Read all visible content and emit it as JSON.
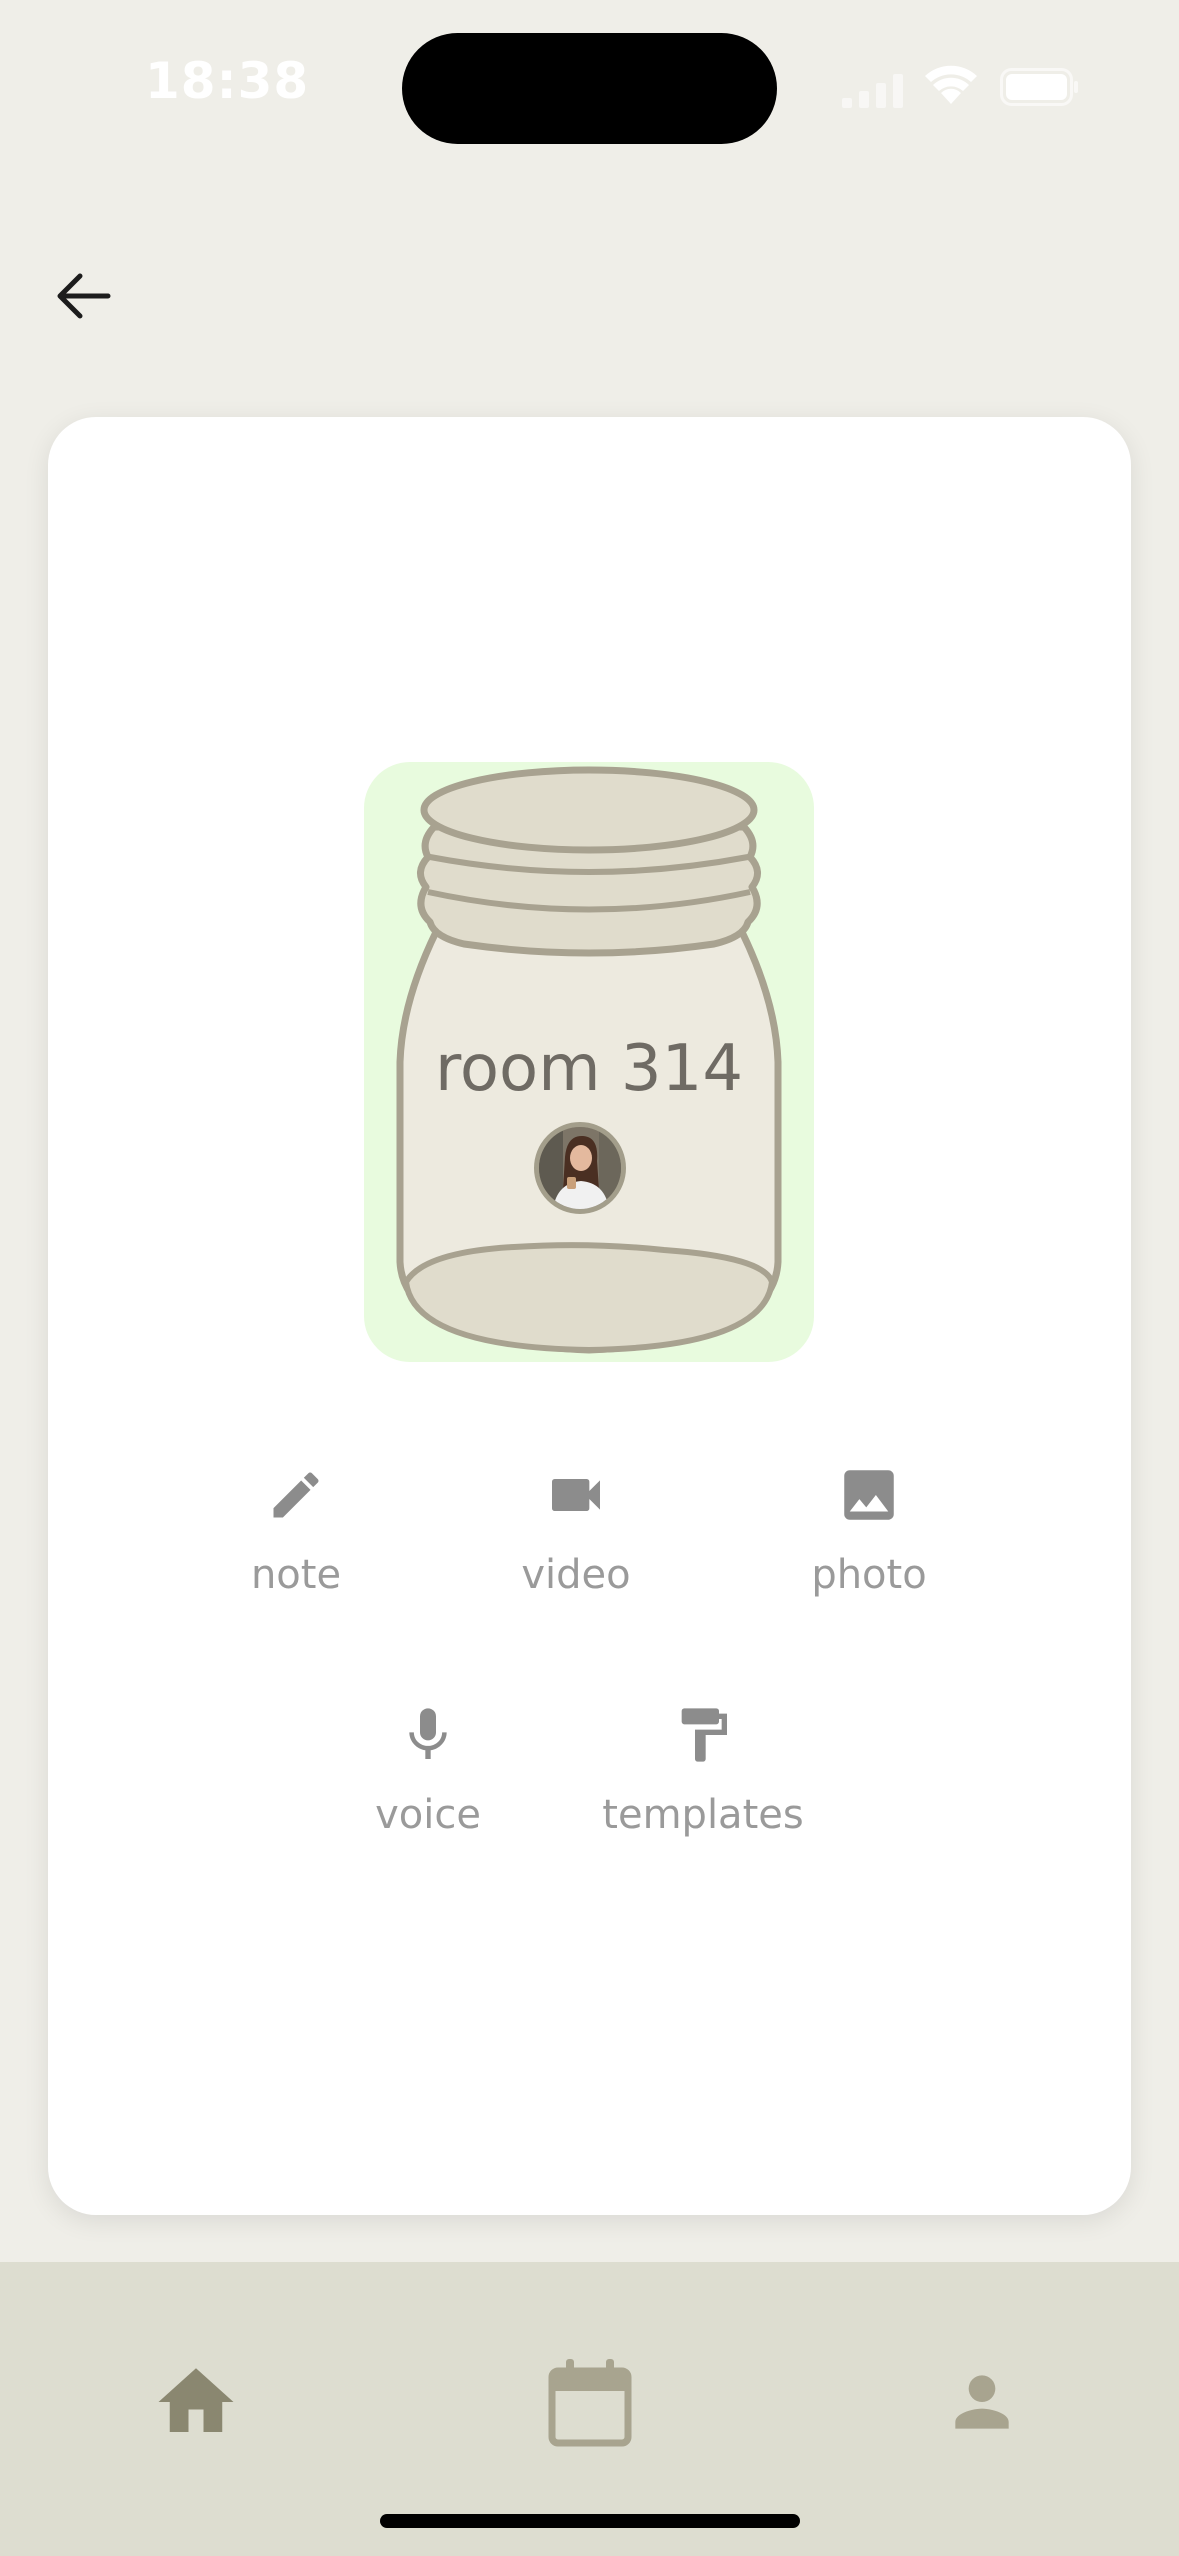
{
  "status_bar": {
    "time": "18:38"
  },
  "header": {
    "back_icon": "arrow-back-icon"
  },
  "jar": {
    "title": "room 314",
    "background_color": "#e8fbde",
    "avatar_icon": "profile-photo"
  },
  "actions": {
    "note": {
      "label": "note",
      "icon": "pencil-icon"
    },
    "video": {
      "label": "video",
      "icon": "videocam-icon"
    },
    "photo": {
      "label": "photo",
      "icon": "image-icon"
    },
    "voice": {
      "label": "voice",
      "icon": "mic-icon"
    },
    "templates": {
      "label": "templates",
      "icon": "paint-roller-icon"
    }
  },
  "bottom_nav": {
    "items": [
      {
        "icon": "home-icon"
      },
      {
        "icon": "calendar-icon"
      },
      {
        "icon": "person-icon"
      }
    ],
    "active_color": "#8a8770",
    "inactive_color": "#a8a48f"
  },
  "colors": {
    "background": "#efeee8",
    "card": "#ffffff",
    "jar_fill": "#edeadf",
    "jar_stroke": "#a8a290",
    "action_icon": "#8c8c8c",
    "action_text": "#9a9a9a"
  }
}
